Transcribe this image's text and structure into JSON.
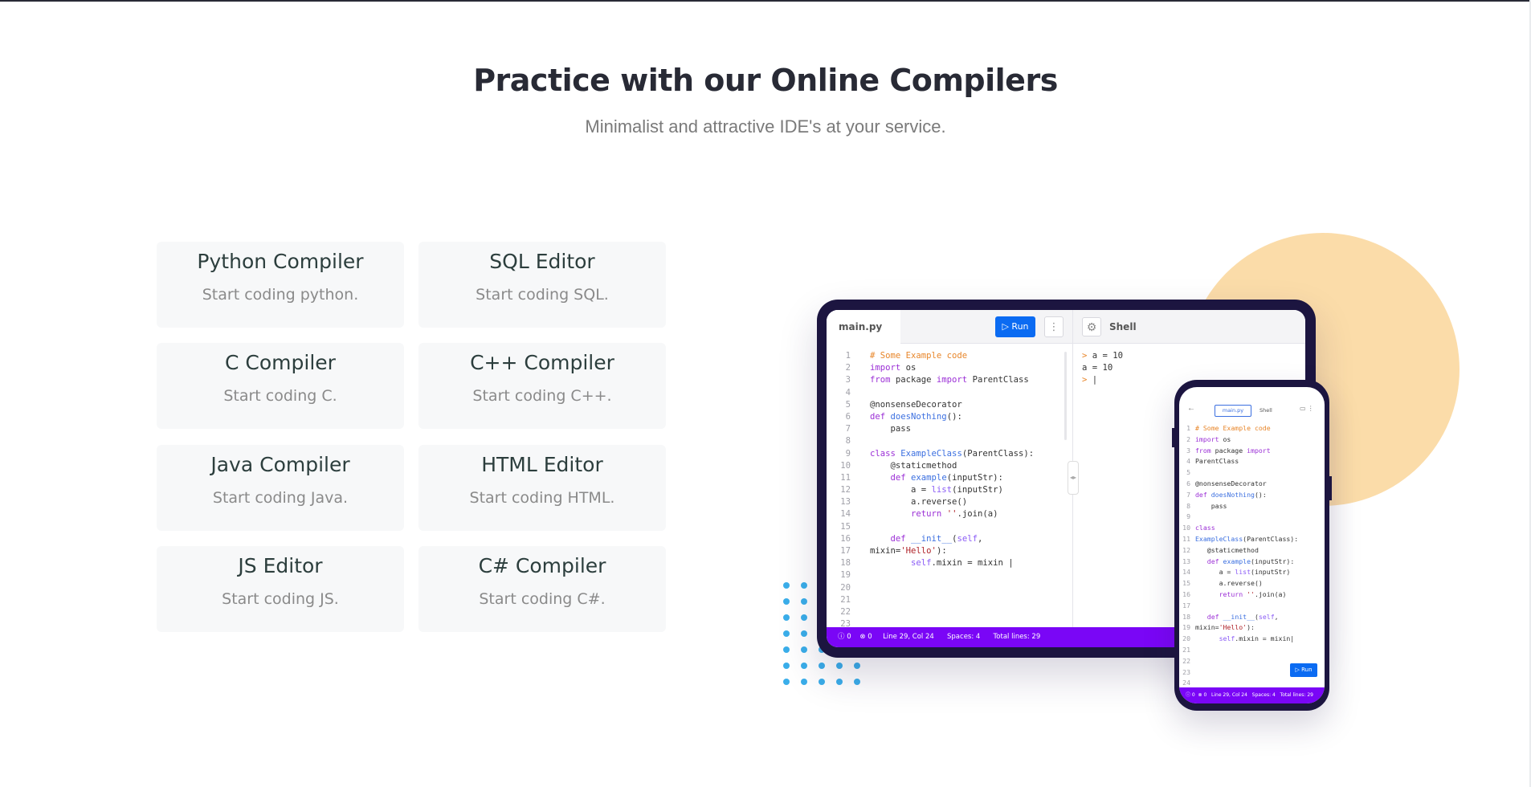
{
  "section": {
    "title": "Practice with our Online Compilers",
    "subtitle": "Minimalist and attractive IDE's at your service."
  },
  "cards": [
    {
      "title": "Python Compiler",
      "subtitle": "Start coding python."
    },
    {
      "title": "SQL Editor",
      "subtitle": "Start coding SQL."
    },
    {
      "title": "C Compiler",
      "subtitle": "Start coding C."
    },
    {
      "title": "C++ Compiler",
      "subtitle": "Start coding C++."
    },
    {
      "title": "Java Compiler",
      "subtitle": "Start coding Java."
    },
    {
      "title": "HTML Editor",
      "subtitle": "Start coding HTML."
    },
    {
      "title": "JS Editor",
      "subtitle": "Start coding JS."
    },
    {
      "title": "C# Compiler",
      "subtitle": "Start coding C#."
    }
  ],
  "colors": {
    "accent_blue": "#0b6bf2",
    "status_purple": "#7a06f6",
    "deco_circle": "#fbdca9",
    "deco_dots": "#3aaeea"
  },
  "tablet": {
    "tab_label": "main.py",
    "run_label": "▷ Run",
    "more_icon": "more-vertical-icon",
    "gear_icon": "gear-icon",
    "shell_label": "Shell",
    "status": "ⓘ 0    ⊗ 0     Line 29, Col 24      Spaces: 4      Total lines: 29",
    "shell_lines": [
      "a = 10",
      "a = 10",
      "|"
    ],
    "code_lines": [
      [
        {
          "t": "cm",
          "v": "# Some Example code"
        }
      ],
      [
        {
          "t": "kw",
          "v": "import"
        },
        {
          "t": "tx",
          "v": " os"
        }
      ],
      [
        {
          "t": "kw",
          "v": "from"
        },
        {
          "t": "tx",
          "v": " package "
        },
        {
          "t": "kw",
          "v": "import"
        },
        {
          "t": "tx",
          "v": " ParentClass"
        }
      ],
      [],
      [
        {
          "t": "tx",
          "v": "@nonsenseDecorator"
        }
      ],
      [
        {
          "t": "kw",
          "v": "def"
        },
        {
          "t": "tx",
          "v": " "
        },
        {
          "t": "fn",
          "v": "doesNothing"
        },
        {
          "t": "tx",
          "v": "():"
        }
      ],
      [
        {
          "t": "tx",
          "v": "    pass"
        }
      ],
      [],
      [
        {
          "t": "kw",
          "v": "class"
        },
        {
          "t": "tx",
          "v": " "
        },
        {
          "t": "fn",
          "v": "ExampleClass"
        },
        {
          "t": "tx",
          "v": "(ParentClass):"
        }
      ],
      [
        {
          "t": "tx",
          "v": "    @staticmethod"
        }
      ],
      [
        {
          "t": "tx",
          "v": "    "
        },
        {
          "t": "kw",
          "v": "def"
        },
        {
          "t": "tx",
          "v": " "
        },
        {
          "t": "fn",
          "v": "example"
        },
        {
          "t": "tx",
          "v": "(inputStr):"
        }
      ],
      [
        {
          "t": "tx",
          "v": "        a = "
        },
        {
          "t": "bi",
          "v": "list"
        },
        {
          "t": "tx",
          "v": "(inputStr)"
        }
      ],
      [
        {
          "t": "tx",
          "v": "        a.reverse()"
        }
      ],
      [
        {
          "t": "tx",
          "v": "        "
        },
        {
          "t": "kw",
          "v": "return"
        },
        {
          "t": "tx",
          "v": " "
        },
        {
          "t": "st",
          "v": "''"
        },
        {
          "t": "tx",
          "v": ".join(a)"
        }
      ],
      [],
      [
        {
          "t": "tx",
          "v": "    "
        },
        {
          "t": "kw",
          "v": "def"
        },
        {
          "t": "tx",
          "v": " "
        },
        {
          "t": "fn",
          "v": "__init__"
        },
        {
          "t": "tx",
          "v": "("
        },
        {
          "t": "bi",
          "v": "self"
        },
        {
          "t": "tx",
          "v": ","
        }
      ],
      [
        {
          "t": "tx",
          "v": "mixin="
        },
        {
          "t": "st",
          "v": "'Hello'"
        },
        {
          "t": "tx",
          "v": "):"
        }
      ],
      [
        {
          "t": "tx",
          "v": "        "
        },
        {
          "t": "bi",
          "v": "self"
        },
        {
          "t": "tx",
          "v": ".mixin = mixin |"
        }
      ],
      [],
      [],
      [],
      [],
      []
    ]
  },
  "phone": {
    "back_icon": "arrow-left-icon",
    "tab_label": "main.py",
    "shell_label": "Shell",
    "run_label": "▷ Run",
    "status": "ⓘ 0  ⊗ 0   Line 29, Col 24   Spaces: 4   Total lines: 29",
    "code_lines": [
      [
        {
          "t": "cm",
          "v": "# Some Example code"
        }
      ],
      [
        {
          "t": "kw",
          "v": "import"
        },
        {
          "t": "tx",
          "v": " os"
        }
      ],
      [
        {
          "t": "kw",
          "v": "from"
        },
        {
          "t": "tx",
          "v": " package "
        },
        {
          "t": "kw",
          "v": "import"
        }
      ],
      [
        {
          "t": "tx",
          "v": "ParentClass"
        }
      ],
      [],
      [
        {
          "t": "tx",
          "v": "@nonsenseDecorator"
        }
      ],
      [
        {
          "t": "kw",
          "v": "def"
        },
        {
          "t": "tx",
          "v": " "
        },
        {
          "t": "fn",
          "v": "doesNothing"
        },
        {
          "t": "tx",
          "v": "():"
        }
      ],
      [
        {
          "t": "tx",
          "v": "    pass"
        }
      ],
      [],
      [
        {
          "t": "kw",
          "v": "class"
        }
      ],
      [
        {
          "t": "fn",
          "v": "ExampleClass"
        },
        {
          "t": "tx",
          "v": "(ParentClass):"
        }
      ],
      [
        {
          "t": "tx",
          "v": "   @staticmethod"
        }
      ],
      [
        {
          "t": "tx",
          "v": "   "
        },
        {
          "t": "kw",
          "v": "def"
        },
        {
          "t": "tx",
          "v": " "
        },
        {
          "t": "fn",
          "v": "example"
        },
        {
          "t": "tx",
          "v": "(inputStr):"
        }
      ],
      [
        {
          "t": "tx",
          "v": "      a = "
        },
        {
          "t": "bi",
          "v": "list"
        },
        {
          "t": "tx",
          "v": "(inputStr)"
        }
      ],
      [
        {
          "t": "tx",
          "v": "      a.reverse()"
        }
      ],
      [
        {
          "t": "tx",
          "v": "      "
        },
        {
          "t": "kw",
          "v": "return"
        },
        {
          "t": "tx",
          "v": " "
        },
        {
          "t": "st",
          "v": "''"
        },
        {
          "t": "tx",
          "v": ".join(a)"
        }
      ],
      [],
      [
        {
          "t": "tx",
          "v": "   "
        },
        {
          "t": "kw",
          "v": "def"
        },
        {
          "t": "tx",
          "v": " "
        },
        {
          "t": "fn",
          "v": "__init__"
        },
        {
          "t": "tx",
          "v": "("
        },
        {
          "t": "bi",
          "v": "self"
        },
        {
          "t": "tx",
          "v": ","
        }
      ],
      [
        {
          "t": "tx",
          "v": "mixin="
        },
        {
          "t": "st",
          "v": "'Hello'"
        },
        {
          "t": "tx",
          "v": "):"
        }
      ],
      [
        {
          "t": "tx",
          "v": "      "
        },
        {
          "t": "bi",
          "v": "self"
        },
        {
          "t": "tx",
          "v": ".mixin = mixin|"
        }
      ],
      [],
      [],
      [],
      []
    ]
  }
}
